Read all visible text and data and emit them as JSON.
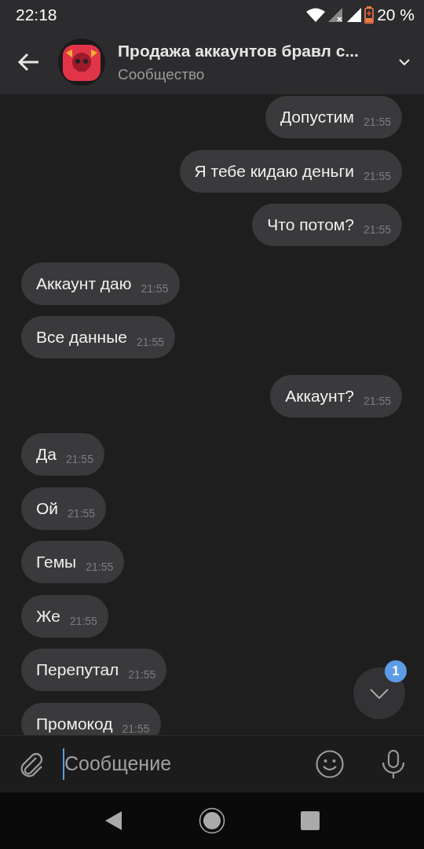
{
  "status_bar": {
    "time": "22:18",
    "battery": "20 %"
  },
  "header": {
    "title": "Продажа аккаунтов бравл с...",
    "subtitle": "Сообщество"
  },
  "messages": [
    {
      "kind": "outgoing",
      "text": "Допустим",
      "time": "21:55"
    },
    {
      "kind": "outgoing",
      "text": "Я тебе кидаю деньги",
      "time": "21:55"
    },
    {
      "kind": "outgoing",
      "text": "Что потом?",
      "time": "21:55"
    },
    {
      "kind": "incoming",
      "text": "Аккаунт даю",
      "time": "21:55"
    },
    {
      "kind": "incoming",
      "text": "Все данные",
      "time": "21:55"
    },
    {
      "kind": "outgoing",
      "text": "Аккаунт?",
      "time": "21:55"
    },
    {
      "kind": "incoming",
      "text": "Да",
      "time": "21:55"
    },
    {
      "kind": "incoming",
      "text": "Ой",
      "time": "21:55"
    },
    {
      "kind": "incoming",
      "text": "Гемы",
      "time": "21:55"
    },
    {
      "kind": "incoming",
      "text": "Же",
      "time": "21:55"
    },
    {
      "kind": "incoming",
      "text": "Перепутал",
      "time": "21:55"
    },
    {
      "kind": "incoming",
      "text": "Промокод",
      "time": "21:55"
    }
  ],
  "scroll_button": {
    "badge": "1"
  },
  "composer": {
    "placeholder": "Сообщение"
  }
}
